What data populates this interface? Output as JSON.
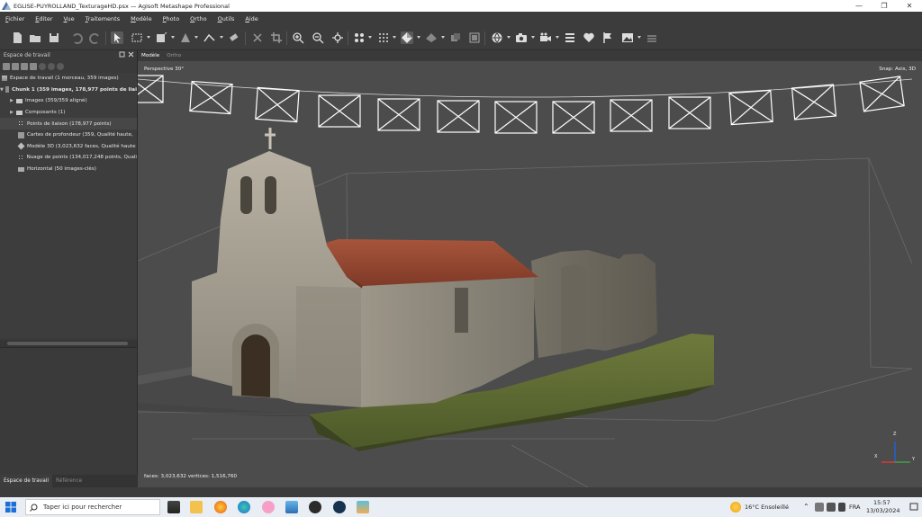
{
  "window": {
    "title": "EGLISE-PUYROLLAND_TexturageHD.psx — Agisoft Metashape Professional",
    "minimize": "—",
    "maximize": "❐",
    "close": "✕"
  },
  "menu": [
    {
      "key": "F",
      "rest": "ichier"
    },
    {
      "key": "E",
      "rest": "diter"
    },
    {
      "key": "V",
      "rest": "ue"
    },
    {
      "key": "T",
      "rest": "raitements"
    },
    {
      "key": "M",
      "rest": "odèle"
    },
    {
      "key": "P",
      "rest": "hoto"
    },
    {
      "key": "O",
      "rest": "rtho"
    },
    {
      "key": "O",
      "rest": "utils"
    },
    {
      "key": "A",
      "rest": "ide"
    }
  ],
  "workspace": {
    "header": "Espace de travail",
    "root": "Espace de travail (1 morceau, 359 images)",
    "chunk": "Chunk 1 (359 images, 178,977 points de liai",
    "items": [
      "Images (359/359 aligné)",
      "Composants (1)",
      "Points de liaison (178,977 points)",
      "Cartes de profondeur (359, Qualité haute,",
      "Modèle 3D (3,023,632 faces, Qualité haute",
      "Nuage de points (134,017,248 points, Quali",
      "Horizontal (50 images-clés)"
    ],
    "tabs": [
      "Espace de travail",
      "Référence"
    ]
  },
  "viewport": {
    "tabs": [
      "Modèle",
      "Ortho"
    ],
    "projection": "Perspective 30°",
    "snap": "Snap: Axis, 3D",
    "stats": "faces: 3,023,632 vertices: 1,516,760",
    "axis_labels": {
      "z": "Z",
      "x": "X",
      "y": "Y"
    }
  },
  "taskbar": {
    "search_placeholder": "Taper ici pour rechercher",
    "weather": "16°C Ensoleillé",
    "lang": "FRA",
    "time": "15:57",
    "date": "13/03/2024"
  },
  "colors": {
    "accent_red": "#e03a2f",
    "axis_x": "#e53935",
    "axis_y": "#43a047",
    "axis_z": "#1e63d6"
  },
  "icons": {
    "menu_app": "metashape-app-icon",
    "search": "search-icon",
    "taskview": "task-view-icon"
  }
}
